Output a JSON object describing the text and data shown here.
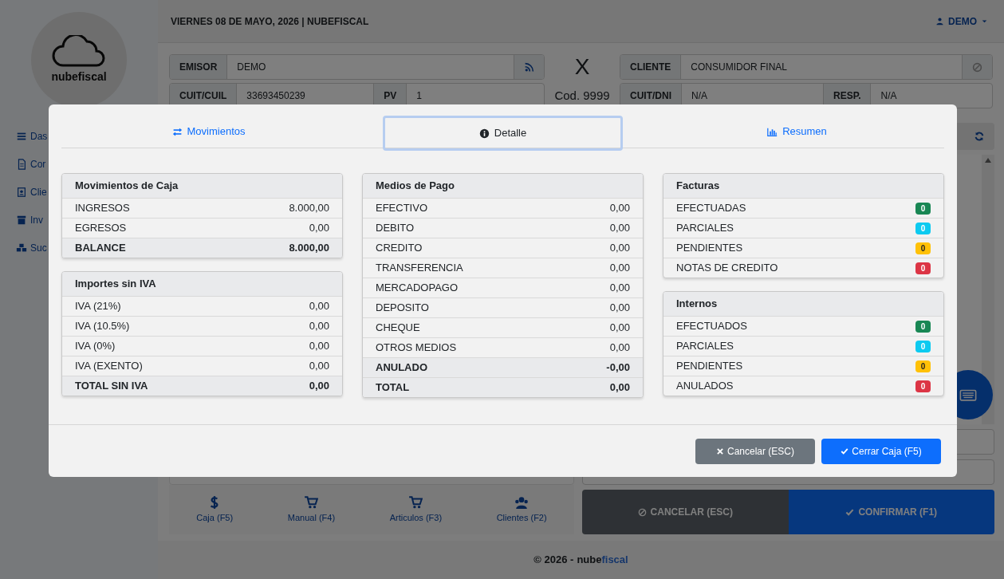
{
  "header": {
    "date": "VIERNES 08 DE MAYO, 2026 | NUBEFISCAL",
    "user": "DEMO"
  },
  "logo": {
    "text": "nubefiscal"
  },
  "sidebar": {
    "items": [
      {
        "label": "Das"
      },
      {
        "label": "Cor"
      },
      {
        "label": "Clie"
      },
      {
        "label": "Inv"
      },
      {
        "label": "Suc"
      }
    ]
  },
  "form": {
    "emisor_label": "EMISOR",
    "emisor": "DEMO",
    "letter": "X",
    "code": "Cod. 9999",
    "cliente_label": "CLIENTE",
    "cliente": "CONSUMIDOR FINAL",
    "cuit_label": "CUIT/CUIL",
    "cuit": "33693450239",
    "pv_label": "PV",
    "pv": "1",
    "dni_label": "CUIT/DNI",
    "dni": "N/A",
    "resp_label": "RESP.",
    "resp": "N/A"
  },
  "shortcuts": [
    {
      "label": "Caja (F5)"
    },
    {
      "label": "Manual (F4)"
    },
    {
      "label": "Articulos (F3)"
    },
    {
      "label": "Clientes (F2)"
    }
  ],
  "actions": [
    {
      "label": "CANCELAR (ESC)",
      "kind": "secondary"
    },
    {
      "label": "CONFIRMAR (F1)",
      "kind": "primary"
    }
  ],
  "footer": {
    "text": "© 2026 -",
    "brand_a": "nube",
    "brand_b": "fiscal"
  },
  "modal": {
    "tabs": [
      {
        "label": "Movimientos",
        "selected": false
      },
      {
        "label": "Detalle",
        "selected": true
      },
      {
        "label": "Resumen",
        "selected": false
      }
    ],
    "columns": [
      [
        {
          "title": "Movimientos de Caja",
          "rows": [
            {
              "kind": "value",
              "label": "INGRESOS",
              "value": "8.000,00"
            },
            {
              "kind": "value",
              "label": "EGRESOS",
              "value": "0,00"
            },
            {
              "kind": "total",
              "label": "BALANCE",
              "value": "8.000,00"
            }
          ]
        },
        {
          "title": "Importes sin IVA",
          "rows": [
            {
              "kind": "value",
              "label": "IVA (21%)",
              "value": "0,00"
            },
            {
              "kind": "value",
              "label": "IVA (10.5%)",
              "value": "0,00"
            },
            {
              "kind": "value",
              "label": "IVA (0%)",
              "value": "0,00"
            },
            {
              "kind": "value",
              "label": "IVA (EXENTO)",
              "value": "0,00"
            },
            {
              "kind": "total",
              "label": "TOTAL SIN IVA",
              "value": "0,00"
            }
          ]
        }
      ],
      [
        {
          "title": "Medios de Pago",
          "rows": [
            {
              "kind": "value",
              "label": "EFECTIVO",
              "value": "0,00"
            },
            {
              "kind": "value",
              "label": "DEBITO",
              "value": "0,00"
            },
            {
              "kind": "value",
              "label": "CREDITO",
              "value": "0,00"
            },
            {
              "kind": "value",
              "label": "TRANSFERENCIA",
              "value": "0,00"
            },
            {
              "kind": "value",
              "label": "MERCADOPAGO",
              "value": "0,00"
            },
            {
              "kind": "value",
              "label": "DEPOSITO",
              "value": "0,00"
            },
            {
              "kind": "value",
              "label": "CHEQUE",
              "value": "0,00"
            },
            {
              "kind": "value",
              "label": "OTROS MEDIOS",
              "value": "0,00"
            },
            {
              "kind": "total",
              "label": "ANULADO",
              "value": "-0,00"
            },
            {
              "kind": "total",
              "label": "TOTAL",
              "value": "0,00"
            }
          ]
        }
      ],
      [
        {
          "title": "Facturas",
          "rows": [
            {
              "kind": "badge",
              "label": "EFECTUADAS",
              "value": "0",
              "color": "#198754"
            },
            {
              "kind": "badge",
              "label": "PARCIALES",
              "value": "0",
              "color": "#0dcaf0"
            },
            {
              "kind": "badge",
              "label": "PENDIENTES",
              "value": "0",
              "color": "#ffc107"
            },
            {
              "kind": "badge",
              "label": "NOTAS DE CREDITO",
              "value": "0",
              "color": "#dc3545"
            }
          ]
        },
        {
          "title": "Internos",
          "rows": [
            {
              "kind": "badge",
              "label": "EFECTUADOS",
              "value": "0",
              "color": "#198754"
            },
            {
              "kind": "badge",
              "label": "PARCIALES",
              "value": "0",
              "color": "#0dcaf0"
            },
            {
              "kind": "badge",
              "label": "PENDIENTES",
              "value": "0",
              "color": "#ffc107"
            },
            {
              "kind": "badge",
              "label": "ANULADOS",
              "value": "0",
              "color": "#dc3545"
            }
          ]
        }
      ]
    ],
    "buttons": [
      {
        "label": "Cancelar (ESC)",
        "kind": "secondary"
      },
      {
        "label": "Cerrar Caja (F5)",
        "kind": "primary"
      }
    ]
  }
}
